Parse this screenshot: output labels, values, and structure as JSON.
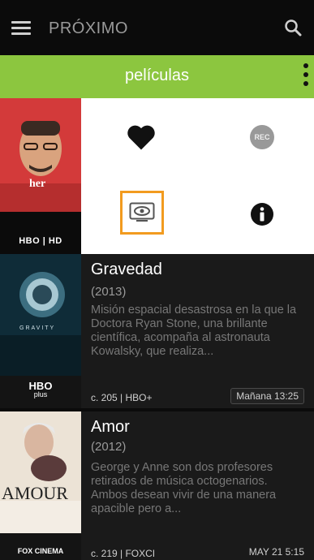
{
  "header": {
    "title": "PRÓXIMO"
  },
  "category": {
    "title": "películas"
  },
  "featured": {
    "poster_title": "her",
    "channel_logo": "HBO | HD"
  },
  "actions": {
    "rec_label": "REC"
  },
  "programs": [
    {
      "title": "Gravedad",
      "year": "(2013)",
      "description": "Misión espacial desastrosa en la que la Doctora Ryan Stone, una brillante científica, acompaña al astronauta Kowalsky, que realiza...",
      "channel_meta": "c. 205 | HBO+",
      "time": "Mañana 13:25",
      "poster_title": "GRAVITY",
      "channel_logo_top": "HBO",
      "channel_logo_bottom": "plus"
    },
    {
      "title": "Amor",
      "year": "(2012)",
      "description": "George y Anne son dos profesores retirados de música octogenarios. Ambos desean vivir de una manera apacible pero a...",
      "channel_meta": "c. 219 | FOXCI",
      "time": "MAY 21 5:15",
      "poster_title": "AMOUR",
      "channel_logo": "FOX CINEMA"
    }
  ],
  "colors": {
    "accent_green": "#8cc63f",
    "highlight_orange": "#f29b1f"
  }
}
